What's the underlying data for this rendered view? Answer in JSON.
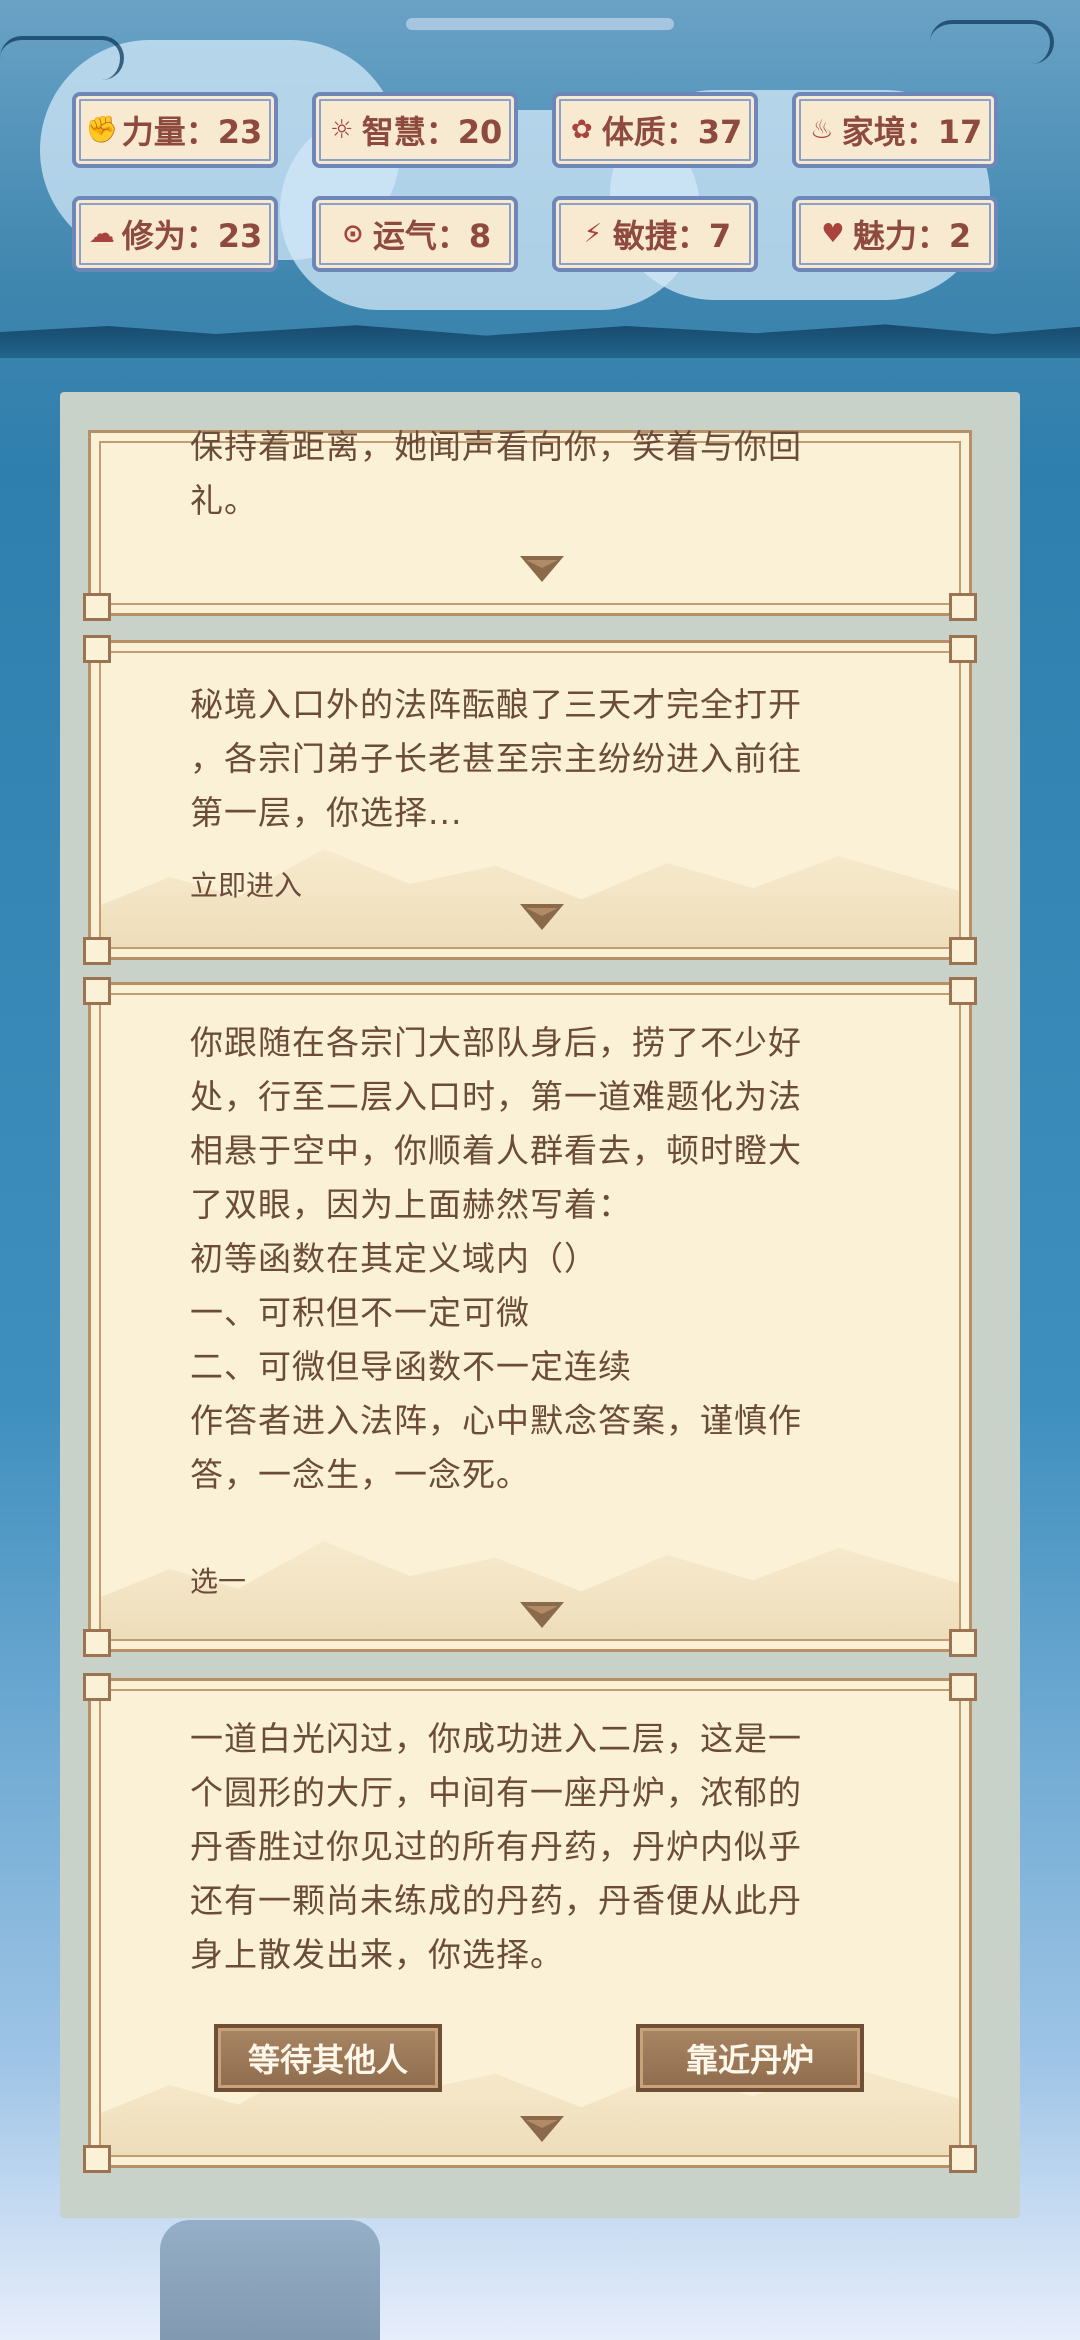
{
  "stats": [
    {
      "label": "力量：23",
      "icon": "strength-icon",
      "glyph": "✊"
    },
    {
      "label": "智慧：20",
      "icon": "wisdom-icon",
      "glyph": "☼"
    },
    {
      "label": "体质：37",
      "icon": "constitution-icon",
      "glyph": "✿"
    },
    {
      "label": "家境：17",
      "icon": "family-icon",
      "glyph": "♨"
    },
    {
      "label": "修为：23",
      "icon": "cultivation-icon",
      "glyph": "☁"
    },
    {
      "label": "运气：8",
      "icon": "luck-icon",
      "glyph": "⊙"
    },
    {
      "label": "敏捷：7",
      "icon": "agility-icon",
      "glyph": "⚡"
    },
    {
      "label": "魅力：2",
      "icon": "charm-icon",
      "glyph": "♥"
    }
  ],
  "cards": [
    {
      "lines": [
        "保持着距离，她闻声看向你，笑着与你回",
        "礼。"
      ]
    },
    {
      "lines": [
        "秘境入口外的法阵酝酿了三天才完全打开",
        "，各宗门弟子长老甚至宗主纷纷进入前往",
        "第一层，你选择..."
      ],
      "choice": "立即进入"
    },
    {
      "lines": [
        "你跟随在各宗门大部队身后，捞了不少好",
        "处，行至二层入口时，第一道难题化为法",
        "相悬于空中，你顺着人群看去，顿时瞪大",
        "了双眼，因为上面赫然写着：",
        "初等函数在其定义域内（）",
        "一、可积但不一定可微",
        "二、可微但导函数不一定连续",
        "作答者进入法阵，心中默念答案，谨慎作",
        "答，一念生，一念死。"
      ],
      "choice": "选一"
    },
    {
      "lines": [
        "一道白光闪过，你成功进入二层，这是一",
        "个圆形的大厅，中间有一座丹炉，浓郁的",
        "丹香胜过你见过的所有丹药，丹炉内似乎",
        "还有一颗尚未练成的丹药，丹香便从此丹",
        "身上散发出来，你选择。"
      ],
      "buttons": [
        "等待其他人",
        "靠近丹炉"
      ]
    }
  ]
}
